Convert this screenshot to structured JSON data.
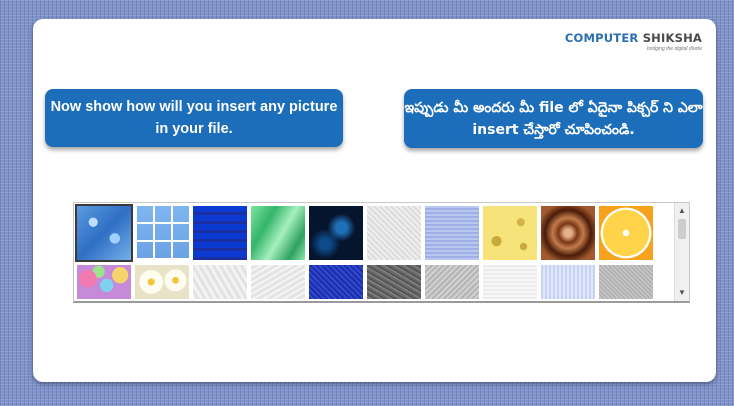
{
  "logo": {
    "brand_a": "COMPUTER",
    "brand_b": "SHIKSHA",
    "tagline": "bridging the digital divide"
  },
  "instruction_en": "Now show how will you insert any picture in your file.",
  "instruction_te": "ఇప్పుడు మీ అందరు మీ file లో ఏదైనా పిక్చర్ ని ఎలా insert చేస్తారో చూపించండి.",
  "texture_gallery": {
    "row1": [
      "water-droplets",
      "blue-tiles",
      "blue-mosaic",
      "green-marble",
      "dark-swirl",
      "white-paper",
      "blue-fabric",
      "cheese",
      "brown-swirl",
      "orange-slice"
    ],
    "row2": [
      "candies",
      "daisies",
      "white-crumpled",
      "white-paper-2",
      "blue-denim",
      "dark-granite",
      "gray-granite",
      "light-paper",
      "blue-knit",
      "gray-sand"
    ],
    "selected": "water-droplets"
  }
}
